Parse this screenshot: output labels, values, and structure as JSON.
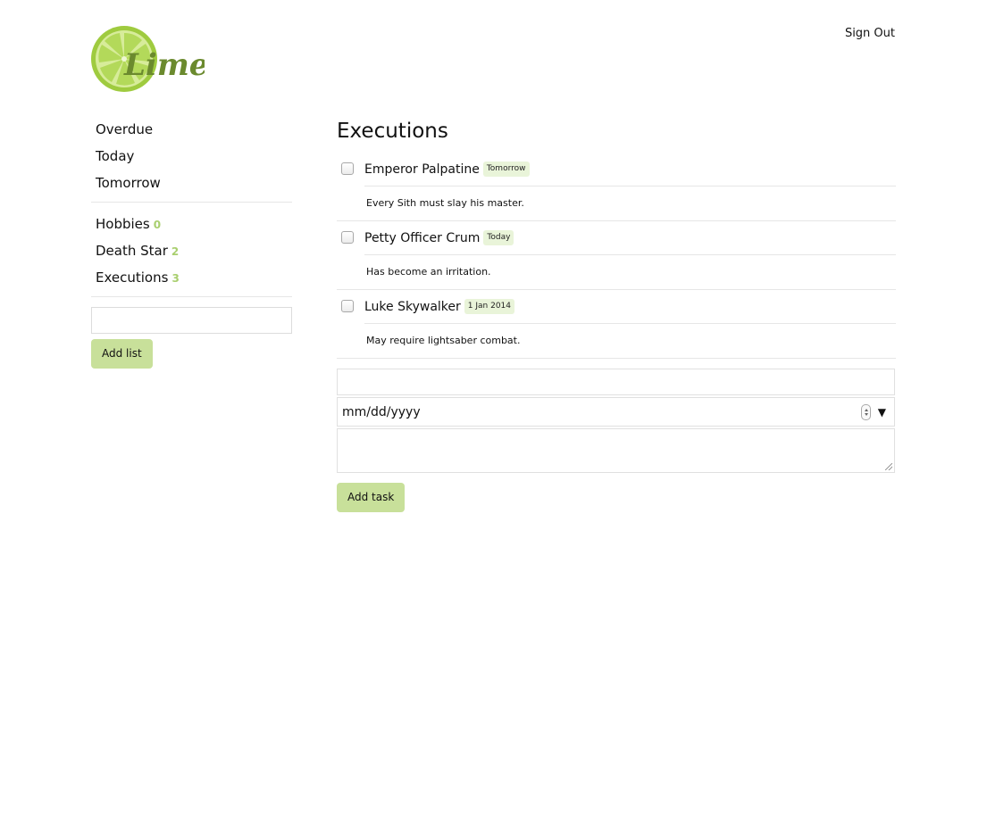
{
  "header": {
    "logo_text": "Lime",
    "signout_label": "Sign Out"
  },
  "sidebar": {
    "filters": [
      {
        "label": "Overdue"
      },
      {
        "label": "Today"
      },
      {
        "label": "Tomorrow"
      }
    ],
    "lists": [
      {
        "label": "Hobbies",
        "count": "0"
      },
      {
        "label": "Death Star",
        "count": "2"
      },
      {
        "label": "Executions",
        "count": "3"
      }
    ],
    "new_list_value": "",
    "add_list_label": "Add list"
  },
  "main": {
    "title": "Executions",
    "tasks": [
      {
        "title": "Emperor Palpatine",
        "due": "Tomorrow",
        "note": "Every Sith must slay his master."
      },
      {
        "title": "Petty Officer Crum",
        "due": "Today",
        "note": "Has become an irritation."
      },
      {
        "title": "Luke Skywalker",
        "due": "1 Jan 2014",
        "note": "May require lightsaber combat."
      }
    ],
    "form": {
      "title_value": "",
      "date_placeholder": "mm/dd/yyyy",
      "notes_value": "",
      "add_task_label": "Add task"
    }
  },
  "colors": {
    "accent": "#c8e09a",
    "count": "#a9cf6f",
    "badge_bg": "#e9f4d9",
    "logo_light": "#a8d04a",
    "logo_dark": "#6b8a2e"
  }
}
